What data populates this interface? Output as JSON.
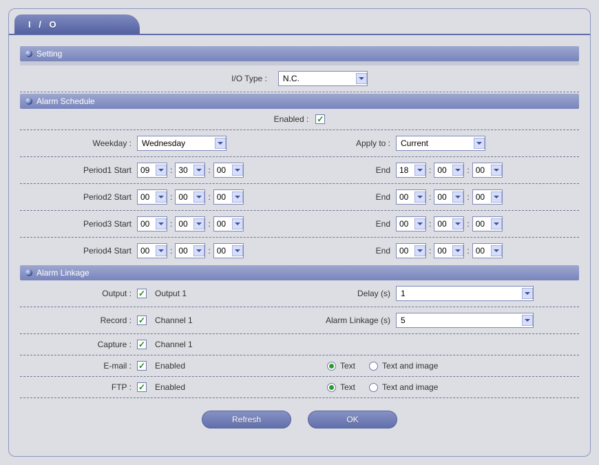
{
  "tab_title": "I / O",
  "sections": {
    "setting": "Setting",
    "schedule": "Alarm Schedule",
    "linkage": "Alarm Linkage"
  },
  "setting": {
    "io_type_label": "I/O Type :",
    "io_type_value": "N.C."
  },
  "schedule": {
    "enabled_label": "Enabled :",
    "enabled": true,
    "weekday_label": "Weekday :",
    "weekday_value": "Wednesday",
    "apply_to_label": "Apply to :",
    "apply_to_value": "Current",
    "end_label": "End",
    "periods": [
      {
        "label": "Period1 Start",
        "start": [
          "09",
          "30",
          "00"
        ],
        "end": [
          "18",
          "00",
          "00"
        ]
      },
      {
        "label": "Period2 Start",
        "start": [
          "00",
          "00",
          "00"
        ],
        "end": [
          "00",
          "00",
          "00"
        ]
      },
      {
        "label": "Period3 Start",
        "start": [
          "00",
          "00",
          "00"
        ],
        "end": [
          "00",
          "00",
          "00"
        ]
      },
      {
        "label": "Period4 Start",
        "start": [
          "00",
          "00",
          "00"
        ],
        "end": [
          "00",
          "00",
          "00"
        ]
      }
    ]
  },
  "linkage": {
    "output_label": "Output :",
    "output_checked": true,
    "output_text": "Output 1",
    "delay_label": "Delay (s)",
    "delay_value": "1",
    "record_label": "Record :",
    "record_checked": true,
    "record_text": "Channel 1",
    "alarm_linkage_label": "Alarm Linkage (s)",
    "alarm_linkage_value": "5",
    "capture_label": "Capture :",
    "capture_checked": true,
    "capture_text": "Channel 1",
    "email_label": "E-mail :",
    "email_checked": true,
    "email_enabled_text": "Enabled",
    "ftp_label": "FTP :",
    "ftp_checked": true,
    "ftp_enabled_text": "Enabled",
    "radio_text": "Text",
    "radio_text_image": "Text and image",
    "email_mode": "text",
    "ftp_mode": "text"
  },
  "buttons": {
    "refresh": "Refresh",
    "ok": "OK"
  }
}
